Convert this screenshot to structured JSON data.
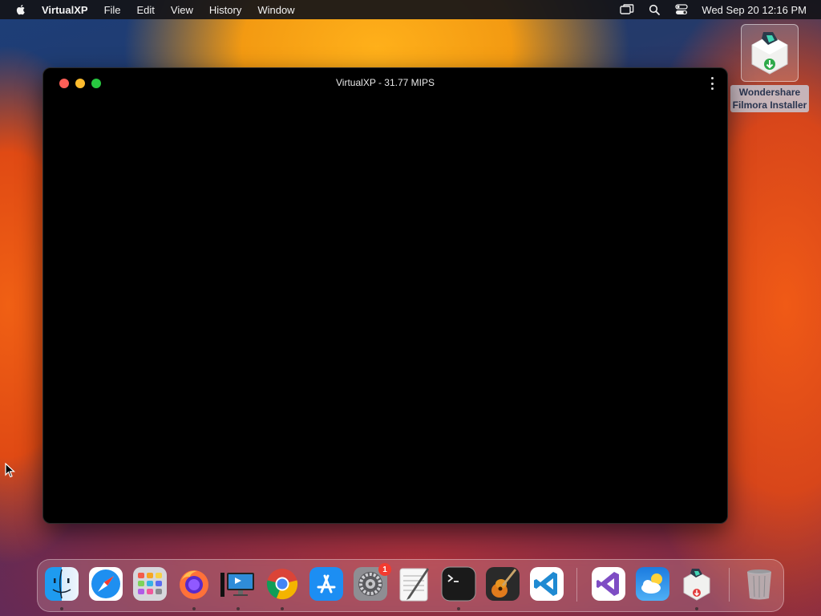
{
  "menubar": {
    "app_name": "VirtualXP",
    "menus": [
      "File",
      "Edit",
      "View",
      "History",
      "Window"
    ],
    "clock": "Wed Sep 20  12:16 PM",
    "tray_icons": [
      "screen-mirror-icon",
      "search-icon",
      "control-center-icon"
    ]
  },
  "desktop_icon": {
    "label_line1": "Wondershare",
    "label_line2": "Filmora Installer",
    "icon": "filmora-installer-icon"
  },
  "window": {
    "title": "VirtualXP - 31.77 MIPS"
  },
  "dock": {
    "items": [
      {
        "name": "finder",
        "running": true
      },
      {
        "name": "safari",
        "running": false
      },
      {
        "name": "launchpad",
        "running": false
      },
      {
        "name": "firefox",
        "running": true
      },
      {
        "name": "remote-desktop",
        "running": true
      },
      {
        "name": "chrome",
        "running": true
      },
      {
        "name": "app-store",
        "running": false
      },
      {
        "name": "system-settings",
        "running": false,
        "badge": "1"
      },
      {
        "name": "textedit",
        "running": false
      },
      {
        "name": "terminal",
        "running": true
      },
      {
        "name": "garageband",
        "running": false
      },
      {
        "name": "vscode",
        "running": false
      },
      {
        "name": "visual-studio",
        "running": false
      },
      {
        "name": "weather",
        "running": false
      },
      {
        "name": "filmora-installer",
        "running": true
      },
      {
        "name": "trash",
        "running": false
      }
    ]
  },
  "colors": {
    "close": "#fe5f57",
    "minimize": "#febc2e",
    "maximize": "#28c840",
    "badge": "#f33b30"
  }
}
